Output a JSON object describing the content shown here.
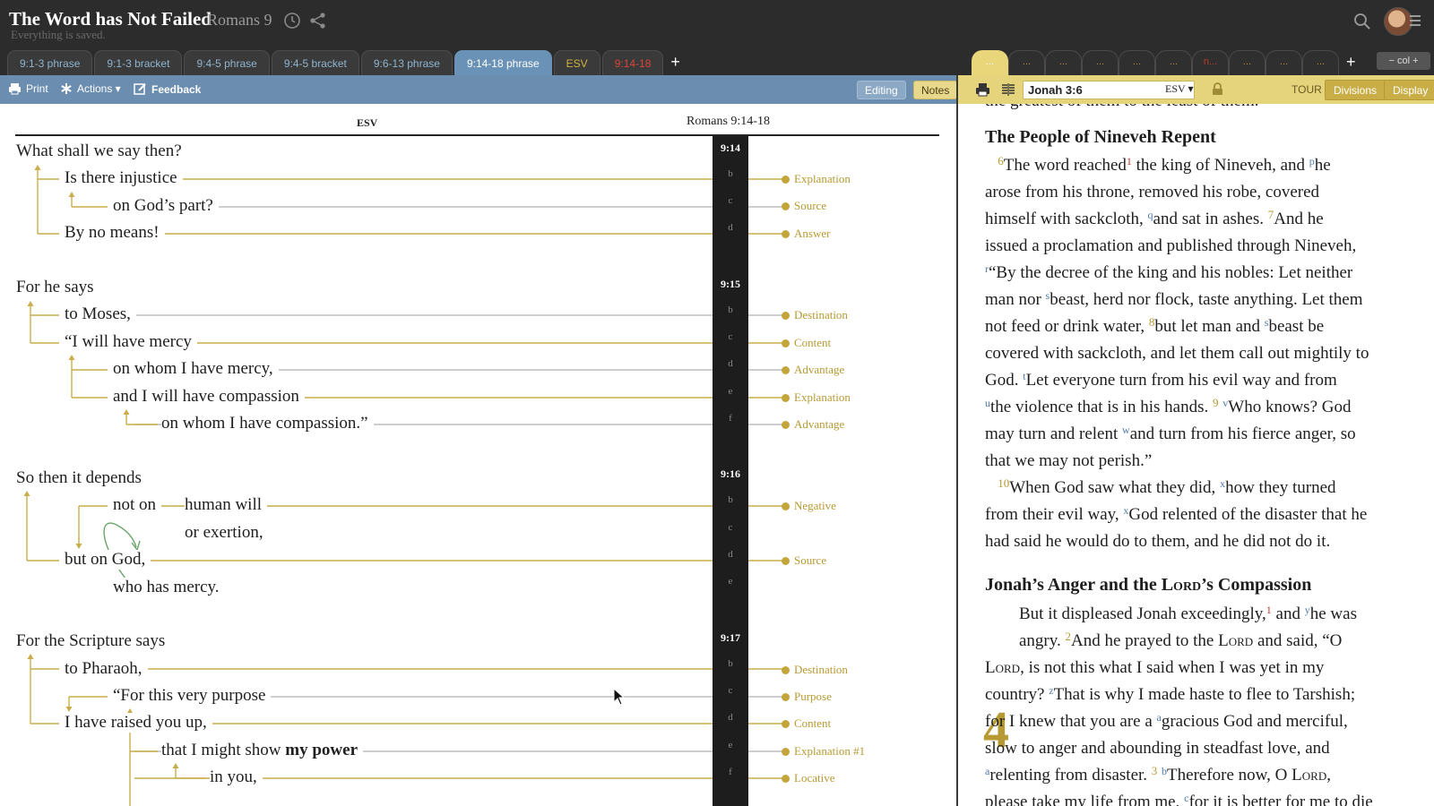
{
  "app": {
    "title": "The Word has Not Failed",
    "subtitle": "Romans 9",
    "status": "Everything is saved."
  },
  "left_tabs": [
    {
      "label": "9:1-3 phrase",
      "state": "normal"
    },
    {
      "label": "9:1-3 bracket",
      "state": "normal"
    },
    {
      "label": "9:4-5 phrase",
      "state": "normal"
    },
    {
      "label": "9:4-5 bracket",
      "state": "normal"
    },
    {
      "label": "9:6-13 phrase",
      "state": "normal"
    },
    {
      "label": "9:14-18 phrase",
      "state": "active"
    },
    {
      "label": "ESV",
      "state": "gold"
    },
    {
      "label": "9:14-18",
      "state": "red"
    }
  ],
  "add_tab_label": "+",
  "right_tabs": [
    "...",
    "...",
    "...",
    "...",
    "...",
    "...",
    "n...",
    "...",
    "...",
    "..."
  ],
  "right_add_tab_label": "+",
  "col_control": "− col +",
  "toolbar": {
    "print": "Print",
    "actions": "Actions ▾",
    "feedback": "Feedback",
    "editing": "Editing",
    "notes": "Notes"
  },
  "phrase_view": {
    "translation": "ESV",
    "reference": "Romans 9:14-18",
    "phrases": [
      "What shall we say then?",
      "Is there injustice",
      "on God’s part?",
      "By no means!",
      "For he says",
      "to Moses,",
      "“I will have mercy",
      "on whom I have mercy,",
      "and I will have compassion",
      "on whom I have compassion.”",
      "So then it depends",
      "not on",
      "human will",
      "or exertion,",
      "but on God,",
      "who has mercy.",
      "For the Scripture says",
      "to Pharaoh,",
      "“For this very purpose",
      "I have raised you up,",
      "that I might show",
      "my power",
      "in you,"
    ],
    "verse_numbers": [
      "9:14",
      "9:15",
      "9:16",
      "9:17"
    ],
    "verse_letters": [
      "b",
      "c",
      "d",
      "b",
      "c",
      "d",
      "e",
      "f",
      "b",
      "c",
      "d",
      "e",
      "b",
      "c",
      "d",
      "e",
      "f"
    ],
    "labels": [
      "Explanation",
      "Source",
      "Answer",
      "Destination",
      "Content",
      "Advantage",
      "Explanation",
      "Advantage",
      "Negative",
      "Source",
      "Destination",
      "Purpose",
      "Content",
      "Explanation #1",
      "Locative"
    ]
  },
  "right_panel": {
    "reference": "Jonah 3:6",
    "version": "ESV ▾",
    "tour": "TOUR",
    "divisions": "Divisions",
    "display": "Display",
    "cut_text": "the greatest of them to the least of them.",
    "heading1": "The People of Nineveh Repent",
    "heading2_a": "Jonah’s Anger and the ",
    "heading2_lord": "Lord",
    "heading2_b": "’s Compassion",
    "chapter_number": "4"
  },
  "colors": {
    "accent_blue": "#6b8daf",
    "gold": "#b79a33",
    "red": "#c0392b"
  }
}
